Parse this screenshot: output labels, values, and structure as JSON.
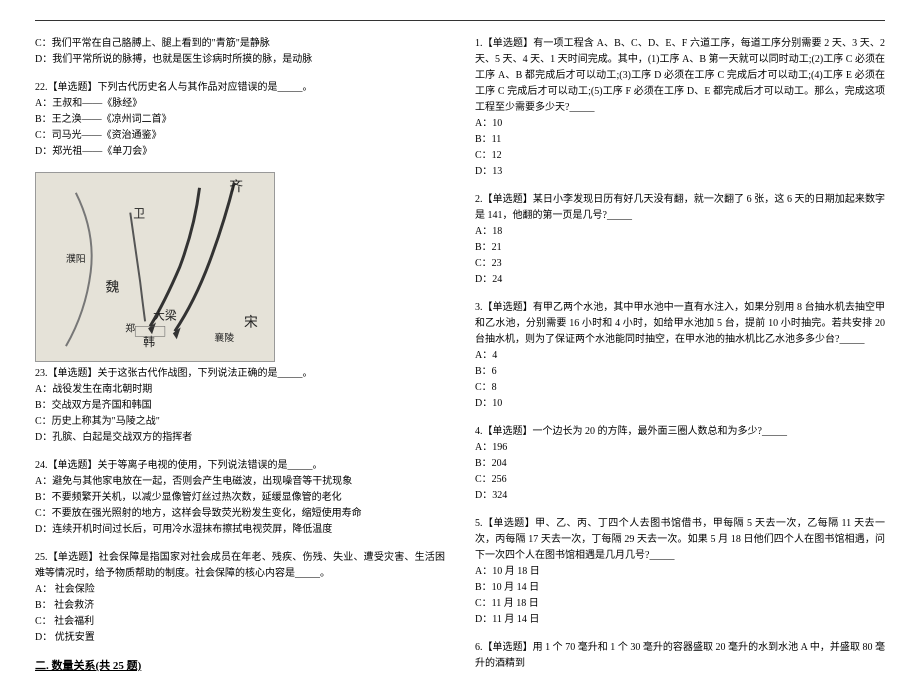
{
  "left": {
    "q21_tail": {
      "optC": "C：我们平常在自己胳膊上、腿上看到的\"青筋\"是静脉",
      "optD": "D：我们平常所说的脉搏，也就是医生诊病时所摸的脉，是动脉"
    },
    "q22": {
      "stem": "22.【单选题】下列古代历史名人与其作品对应错误的是_____。",
      "optA": "A：王叔和——《脉经》",
      "optB": "B：王之涣——《凉州词二首》",
      "optC": "C：司马光——《资治通鉴》",
      "optD": "D：郑光祖——《单刀会》"
    },
    "q23": {
      "stem": "23.【单选题】关于这张古代作战图，下列说法正确的是_____。",
      "optA": "A：战役发生在南北朝时期",
      "optB": "B：交战双方是齐国和韩国",
      "optC": "C：历史上称其为\"马陵之战\"",
      "optD": "D：孔膑、白起是交战双方的指挥者"
    },
    "q24": {
      "stem": "24.【单选题】关于等离子电视的使用，下列说法错误的是_____。",
      "optA": "A：避免与其他家电放在一起，否则会产生电磁波，出现噪音等干扰现象",
      "optB": "B：不要频繁开关机，以减少显像管灯丝过热次数，延缓显像管的老化",
      "optC": "C：不要放在强光照射的地方，这样会导致荧光粉发生变化，缩短使用寿命",
      "optD": "D：连续开机时间过长后，可用冷水湿抹布擦拭电视荧屏，降低温度"
    },
    "q25": {
      "stem": "25.【单选题】社会保障是指国家对社会成员在年老、残疾、伤残、失业、遭受灾害、生活困难等情况时，给予物质帮助的制度。社会保障的核心内容是_____。",
      "optA": "A：  社会保险",
      "optB": "B：  社会救济",
      "optC": "C：  社会福利",
      "optD": "D：  优抚安置"
    },
    "sectionTitle": "二. 数量关系(共 25 题)"
  },
  "right": {
    "q1": {
      "stem": "1.【单选题】有一项工程含 A、B、C、D、E、F 六道工序，每道工序分别需要 2 天、3 天、2 天、5 天、4 天、1 天时间完成。其中，(1)工序 A、B 第一天就可以同时动工;(2)工序 C 必须在工序 A、B 都完成后才可以动工;(3)工序 D 必须在工序 C 完成后才可以动工;(4)工序 E 必须在工序 C 完成后才可以动工;(5)工序 F 必须在工序 D、E 都完成后才可以动工。那么，完成这项工程至少需要多少天?_____",
      "optA": "A：10",
      "optB": "B：11",
      "optC": "C：12",
      "optD": "D：13"
    },
    "q2": {
      "stem": "2.【单选题】某日小李发现日历有好几天没有翻，就一次翻了 6 张，这 6 天的日期加起来数字是 141，他翻的第一页是几号?_____",
      "optA": "A：18",
      "optB": "B：21",
      "optC": "C：23",
      "optD": "D：24"
    },
    "q3": {
      "stem": "3.【单选题】有甲乙两个水池，其中甲水池中一直有水注入，如果分别用 8 台抽水机去抽空甲和乙水池，分别需要 16 小时和 4 小时，如给甲水池加 5 台，提前 10 小时抽完。若共安排 20 台抽水机，则为了保证两个水池能同时抽空，在甲水池的抽水机比乙水池多多少台?_____",
      "optA": "A：4",
      "optB": "B：6",
      "optC": "C：8",
      "optD": "D：10"
    },
    "q4": {
      "stem": "4.【单选题】一个边长为 20 的方阵，最外面三圈人数总和为多少?_____",
      "optA": "A：196",
      "optB": "B：204",
      "optC": "C：256",
      "optD": "D：324"
    },
    "q5": {
      "stem": "5.【单选题】甲、乙、丙、丁四个人去图书馆借书，甲每隔 5 天去一次，乙每隔 11 天去一次，丙每隔 17 天去一次，丁每隔 29 天去一次。如果 5 月 18 日他们四个人在图书馆相遇，问下一次四个人在图书馆相遇是几月几号?_____",
      "optA": "A：10 月 18 日",
      "optB": "B：10 月 14 日",
      "optC": "C：11 月 18 日",
      "optD": "D：11 月 14 日"
    },
    "q6": {
      "stem": "6.【单选题】用 1 个 70 毫升和 1 个 30 毫升的容器盛取 20 毫升的水到水池 A 中，并盛取 80 毫升的酒精到"
    }
  },
  "map": {
    "labels": [
      "齐",
      "卫",
      "濮阳",
      "魏",
      "大梁",
      "韩",
      "襄陵",
      "宋",
      "郑"
    ]
  }
}
